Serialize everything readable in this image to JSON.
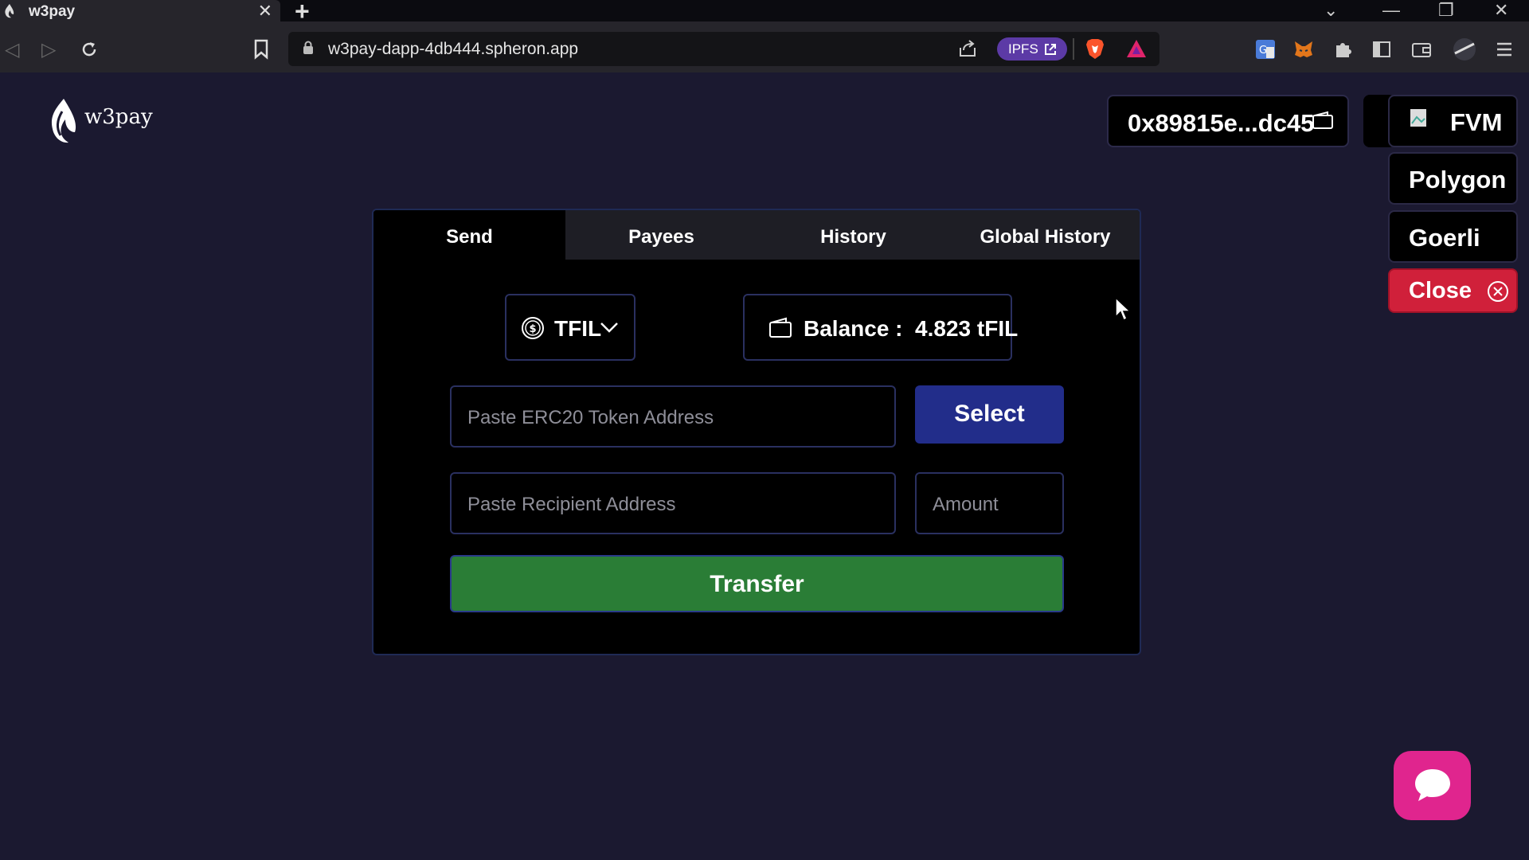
{
  "browser": {
    "tab_title": "w3pay",
    "tab_close": "✕",
    "new_tab": "+",
    "url": "w3pay-dapp-4db444.spheron.app",
    "ipfs_label": "IPFS",
    "window_controls": [
      "⌄",
      "—",
      "❐",
      "✕"
    ]
  },
  "header": {
    "logo_text": "w3pay",
    "wallet_address": "0x89815e...dc45",
    "networks": [
      "FVM",
      "Polygon",
      "Goerli"
    ],
    "close_label": "Close"
  },
  "card": {
    "tabs": [
      "Send",
      "Payees",
      "History",
      "Global History"
    ],
    "active_tab": "Send",
    "token": "TFIL",
    "balance": "Balance :  4.823 tFIL",
    "token_address_placeholder": "Paste ERC20 Token Address",
    "select_label": "Select",
    "recipient_placeholder": "Paste Recipient Address",
    "amount_placeholder": "Amount",
    "transfer_label": "Transfer"
  },
  "colors": {
    "background": "#1b1930",
    "select_button": "#222d8a",
    "transfer_button": "#2a7d36",
    "close_button": "#d0203a",
    "chat_button": "#e0258e",
    "ipfs_pill": "#5c3aa6"
  },
  "icons": [
    "w3pay-favicon",
    "lock-icon",
    "share-icon",
    "brave-icon",
    "bat-icon",
    "translate-icon",
    "metamask-icon",
    "puzzle-icon",
    "sidebar-icon",
    "wallet-icon",
    "profile-icon",
    "menu-icon",
    "flame-logo",
    "dollar-icon",
    "chevron-down-icon",
    "close-circle-icon",
    "chat-icon"
  ]
}
